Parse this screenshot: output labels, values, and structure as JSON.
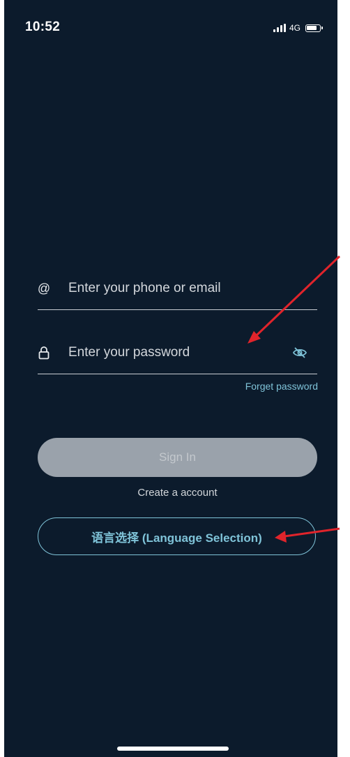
{
  "status_bar": {
    "time": "10:52",
    "network": "4G"
  },
  "login_form": {
    "email_placeholder": "Enter your phone or email",
    "password_placeholder": "Enter your password",
    "forget_password": "Forget password",
    "sign_in": "Sign In",
    "create_account": "Create a account",
    "language_selection": "语言选择 (Language Selection)"
  },
  "icons": {
    "email_field": "at-icon",
    "password_field": "lock-icon",
    "password_toggle": "eye-off-icon"
  },
  "colors": {
    "background": "#0c1b2c",
    "accent": "#7fc3d8",
    "sign_in_button": "#9aa2ab",
    "annotation_arrow": "#e0242b"
  }
}
